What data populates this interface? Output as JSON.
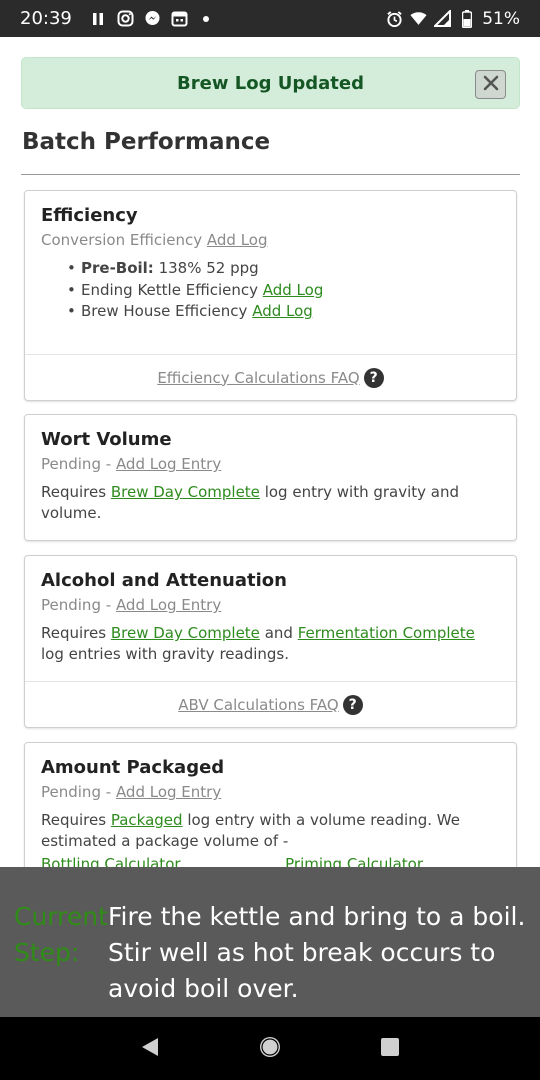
{
  "status_bar": {
    "time": "20:39",
    "battery": "51%",
    "left_icons": [
      "pause-icon",
      "instagram-icon",
      "messenger-icon",
      "calendar-icon",
      "dot-icon"
    ],
    "right_icons": [
      "alarm-icon",
      "wifi-icon",
      "signal-icon",
      "battery-icon"
    ]
  },
  "alert": {
    "message": "Brew Log Updated",
    "close_icon": "close-icon",
    "bg_color": "#d4edda",
    "text_color": "#155724"
  },
  "section": {
    "title": "Batch Performance"
  },
  "cards": {
    "efficiency": {
      "title": "Efficiency",
      "subtitle_prefix": "Conversion Efficiency",
      "subtitle_link": "Add Log",
      "items": {
        "pre_boil_label": "Pre-Boil:",
        "pre_boil_value": "138% 52 ppg",
        "ending_kettle_label": "Ending Kettle Efficiency",
        "ending_kettle_link": "Add Log",
        "brew_house_label": "Brew House Efficiency",
        "brew_house_link": "Add Log"
      },
      "faq_link": "Efficiency Calculations FAQ"
    },
    "wort_volume": {
      "title": "Wort Volume",
      "pending": "Pending -",
      "pending_link": "Add Log Entry",
      "requires": "Requires",
      "link1": "Brew Day Complete",
      "text_after": "log entry with gravity and volume."
    },
    "alcohol": {
      "title": "Alcohol and Attenuation",
      "pending": "Pending -",
      "pending_link": "Add Log Entry",
      "requires": "Requires",
      "link1": "Brew Day Complete",
      "and": "and",
      "link2": "Fermentation Complete",
      "text_after": "log entries with gravity readings.",
      "faq_link": "ABV Calculations FAQ"
    },
    "packaged": {
      "title": "Amount Packaged",
      "pending": "Pending -",
      "pending_link": "Add Log Entry",
      "requires": "Requires",
      "link1": "Packaged",
      "text_after": "log entry with a volume reading. We estimated a package volume of -",
      "calc1": "Bottling Calculator",
      "calc2": "Priming Calculator"
    }
  },
  "current_step": {
    "label": "Current Step:",
    "text": "Fire the kettle and bring to a boil. Stir well as hot break occurs to avoid boil over.",
    "label_color": "#2f8c16"
  },
  "nav_bar": {
    "back_icon": "back-triangle-icon",
    "home_icon": "home-circle-icon",
    "recents_icon": "recents-square-icon"
  },
  "colors": {
    "link_green": "#2e8b1e",
    "muted_gray": "#8a8a8a",
    "overlay_gray": "#5a5a5a"
  }
}
